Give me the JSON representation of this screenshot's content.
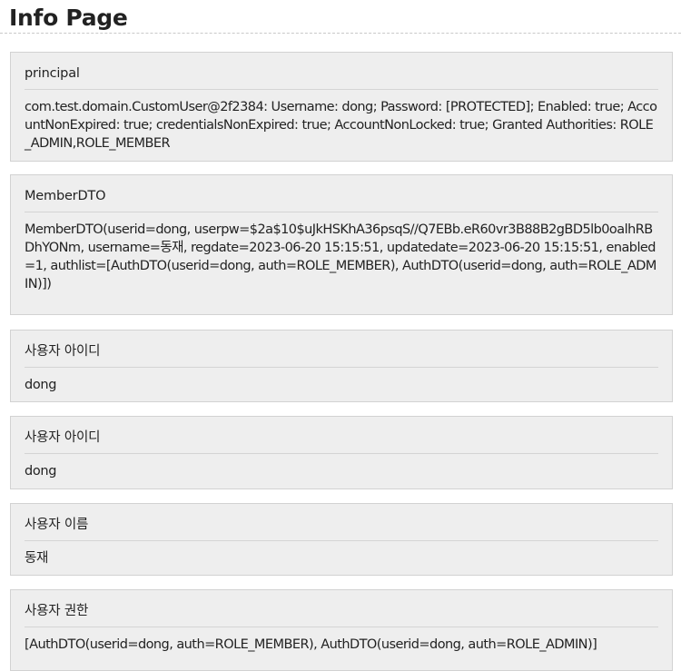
{
  "page": {
    "title": "Info Page"
  },
  "sections": [
    {
      "heading": "principal",
      "body": "com.test.domain.CustomUser@2f2384: Username: dong; Password: [PROTECTED]; Enabled: true; AccountNonExpired: true; credentialsNonExpired: true; AccountNonLocked: true; Granted Authorities: ROLE_ADMIN,ROLE_MEMBER"
    },
    {
      "heading": "MemberDTO",
      "body": "MemberDTO(userid=dong, userpw=$2a$10$uJkHSKhA36psqS//Q7EBb.eR60vr3B88B2gBD5lb0oalhRBDhYONm, username=동재, regdate=2023-06-20 15:15:51, updatedate=2023-06-20 15:15:51, enabled=1, authlist=[AuthDTO(userid=dong, auth=ROLE_MEMBER), AuthDTO(userid=dong, auth=ROLE_ADMIN)])"
    },
    {
      "heading": "사용자 아이디",
      "body": "dong"
    },
    {
      "heading": "사용자 아이디",
      "body": "dong"
    },
    {
      "heading": "사용자 이름",
      "body": "동재"
    },
    {
      "heading": "사용자 권한",
      "body": "[AuthDTO(userid=dong, auth=ROLE_MEMBER), AuthDTO(userid=dong, auth=ROLE_ADMIN)]"
    }
  ]
}
